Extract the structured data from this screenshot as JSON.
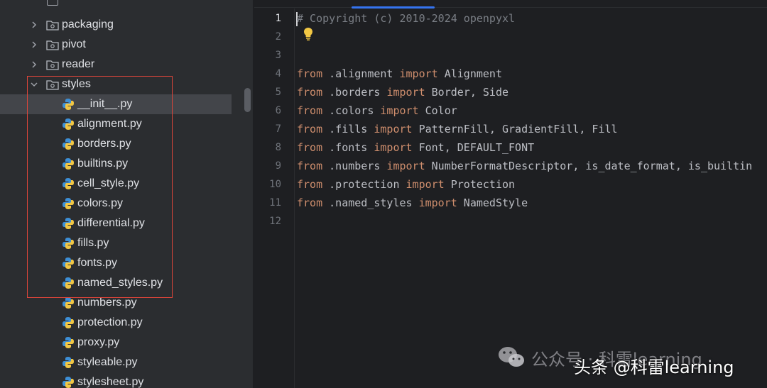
{
  "project_tree": {
    "folders": [
      {
        "name": "packaging",
        "expanded": false
      },
      {
        "name": "pivot",
        "expanded": false
      },
      {
        "name": "reader",
        "expanded": false
      },
      {
        "name": "styles",
        "expanded": true
      }
    ],
    "files": [
      {
        "name": "__init__.py",
        "selected": true
      },
      {
        "name": "alignment.py"
      },
      {
        "name": "borders.py"
      },
      {
        "name": "builtins.py"
      },
      {
        "name": "cell_style.py"
      },
      {
        "name": "colors.py"
      },
      {
        "name": "differential.py"
      },
      {
        "name": "fills.py"
      },
      {
        "name": "fonts.py"
      },
      {
        "name": "named_styles.py"
      },
      {
        "name": "numbers.py"
      },
      {
        "name": "protection.py"
      },
      {
        "name": "proxy.py"
      },
      {
        "name": "styleable.py"
      },
      {
        "name": "stylesheet.py"
      }
    ],
    "highlight_color": "#e0453a"
  },
  "editor": {
    "current_line": 1,
    "line_numbers": [
      "1",
      "2",
      "3",
      "4",
      "5",
      "6",
      "7",
      "8",
      "9",
      "10",
      "11",
      "12"
    ],
    "lines": [
      {
        "comment": "# Copyright (c) 2010-2024 openpyxl"
      },
      {},
      {},
      {
        "kw1": "from",
        "mod": " .alignment ",
        "kw2": "import",
        "names": " Alignment"
      },
      {
        "kw1": "from",
        "mod": " .borders ",
        "kw2": "import",
        "names": " Border, Side"
      },
      {
        "kw1": "from",
        "mod": " .colors ",
        "kw2": "import",
        "names": " Color"
      },
      {
        "kw1": "from",
        "mod": " .fills ",
        "kw2": "import",
        "names": " PatternFill, GradientFill, Fill"
      },
      {
        "kw1": "from",
        "mod": " .fonts ",
        "kw2": "import",
        "names": " Font, DEFAULT_FONT"
      },
      {
        "kw1": "from",
        "mod": " .numbers ",
        "kw2": "import",
        "names": " NumberFormatDescriptor, is_date_format, is_builtin"
      },
      {
        "kw1": "from",
        "mod": " .protection ",
        "kw2": "import",
        "names": " Protection"
      },
      {
        "kw1": "from",
        "mod": " .named_styles ",
        "kw2": "import",
        "names": " NamedStyle"
      },
      {}
    ],
    "colors": {
      "keyword": "#cf8e6d",
      "comment": "#7a7e85",
      "text": "#bcbec4",
      "tab_accent": "#3574f0"
    }
  },
  "watermark": {
    "faint_text": "公众号 · 科雷learning",
    "main_text": "头条 @科雷learning",
    "icon": "wechat-icon"
  }
}
